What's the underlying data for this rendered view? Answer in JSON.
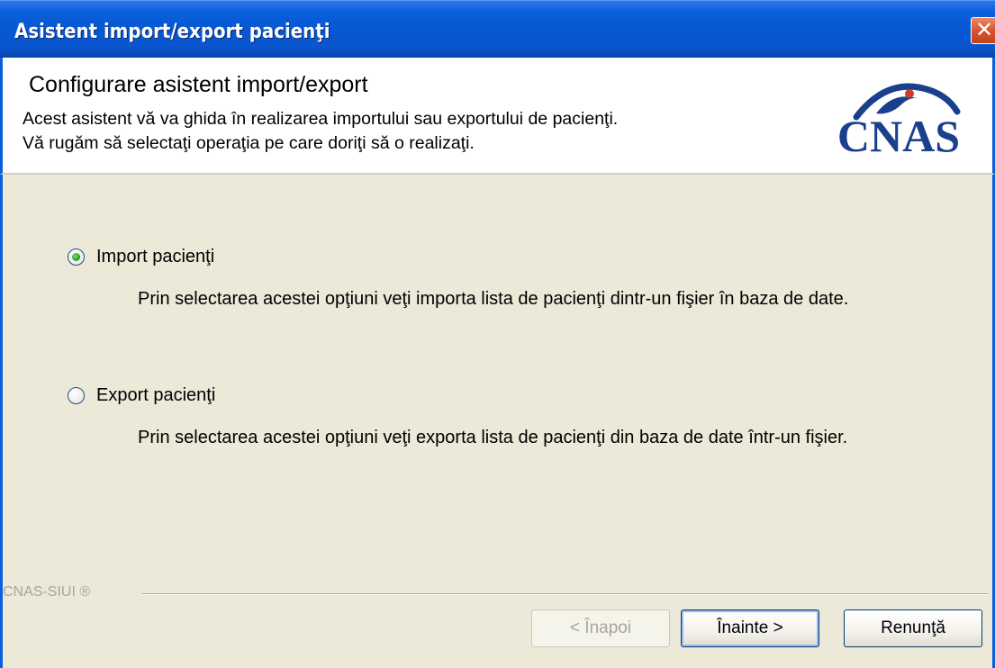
{
  "window": {
    "title": "Asistent import/export pacienţi",
    "close_symbol": "✕"
  },
  "header": {
    "title": "Configurare asistent import/export",
    "description_line1": "Acest asistent vă va ghida în realizarea importului sau exportului de pacienţi.",
    "description_line2": "Vă rugăm să selectaţi operaţia pe care doriţi să o realizaţi.",
    "logo_text": "CNAS"
  },
  "options": {
    "import_label": "Import pacienţi",
    "import_desc": "Prin selectarea acestei opţiuni veţi importa lista de pacienţi dintr-un fişier în baza de date.",
    "export_label": "Export pacienţi",
    "export_desc": "Prin selectarea acestei opţiuni veţi exporta lista de pacienţi din baza de date într-un fişier.",
    "selected": "import"
  },
  "footer": {
    "brand": "CNAS-SIUI ®"
  },
  "buttons": {
    "back": "< Înapoi",
    "next": "Înainte >",
    "cancel": "Renunţă"
  },
  "colors": {
    "titlebar": "#0a5fdb",
    "dialog_bg": "#ece9d8",
    "logo_blue": "#1a3f8c",
    "logo_red": "#d23a2a"
  }
}
